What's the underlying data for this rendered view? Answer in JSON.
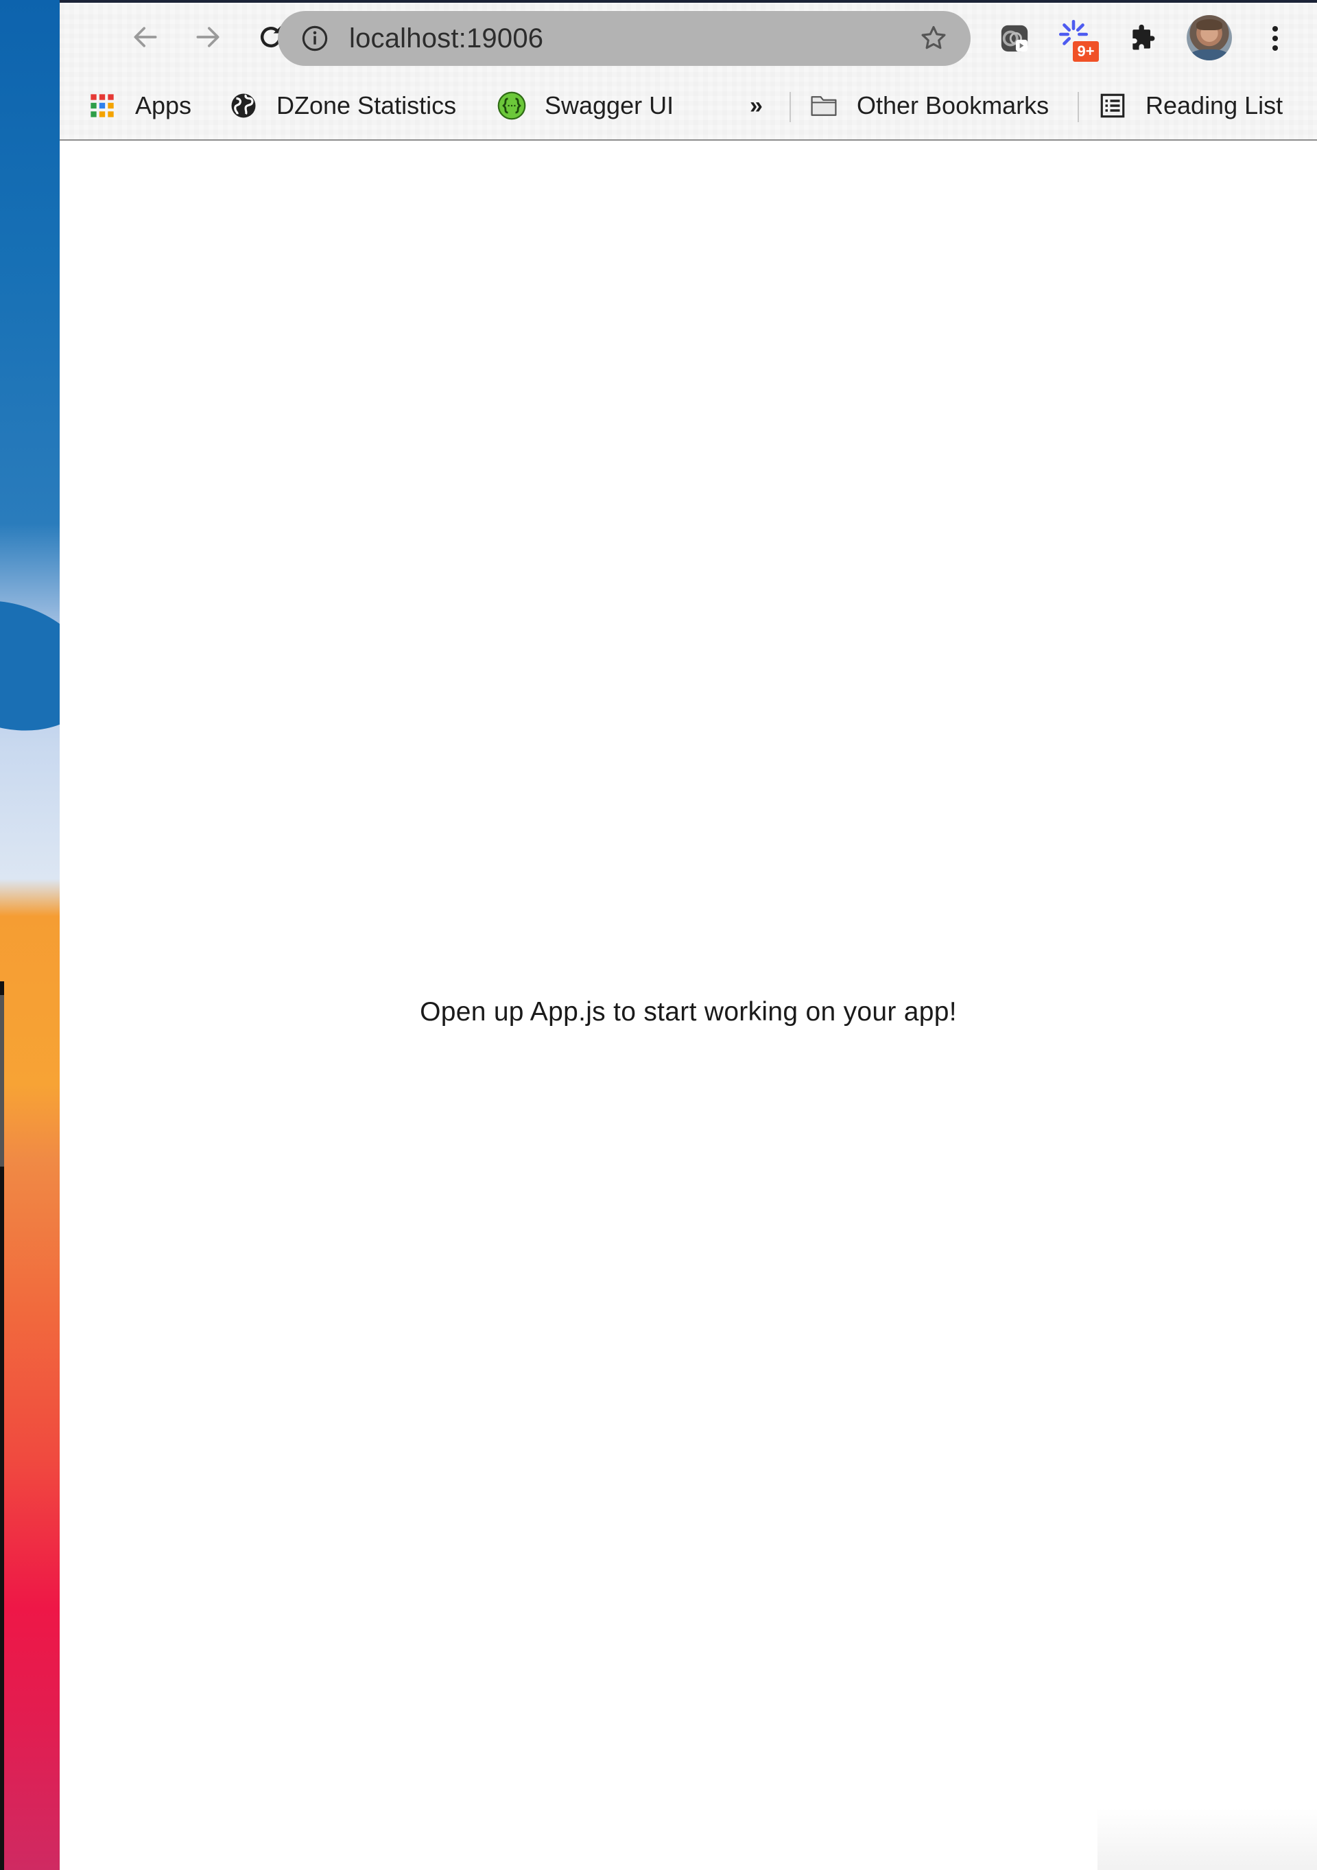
{
  "browser": {
    "url": "localhost:19006",
    "nav": {
      "back_icon": "arrow-left-icon",
      "forward_icon": "arrow-right-icon",
      "reload_icon": "reload-icon"
    },
    "omnibox": {
      "site_info_icon": "info-circle-icon",
      "bookmark_icon": "star-outline-icon"
    },
    "extensions": [
      {
        "name": "extension-screen-recorder",
        "icon": "screen-recorder-icon"
      },
      {
        "name": "extension-sunburst",
        "icon": "sunburst-icon",
        "badge": "9+"
      },
      {
        "name": "extensions-menu",
        "icon": "puzzle-icon"
      }
    ],
    "profile_icon": "avatar",
    "menu_icon": "kebab-menu-icon",
    "colors": {
      "omnibox_bg": "#b3b3b3",
      "badge_bg": "#f05127",
      "swagger_green": "#6cc83a",
      "sunburst_blue": "#4d5bf0"
    }
  },
  "bookmarks_bar": {
    "items": [
      {
        "label": "Apps",
        "icon": "apps-grid-icon"
      },
      {
        "label": "DZone Statistics",
        "icon": "globe-icon"
      },
      {
        "label": "Swagger UI",
        "icon": "swagger-icon"
      }
    ],
    "overflow_label": "»",
    "other_bookmarks": {
      "label": "Other Bookmarks",
      "icon": "folder-icon"
    },
    "reading_list": {
      "label": "Reading List",
      "icon": "reading-list-icon"
    }
  },
  "page": {
    "message": "Open up App.js to start working on your app!"
  }
}
